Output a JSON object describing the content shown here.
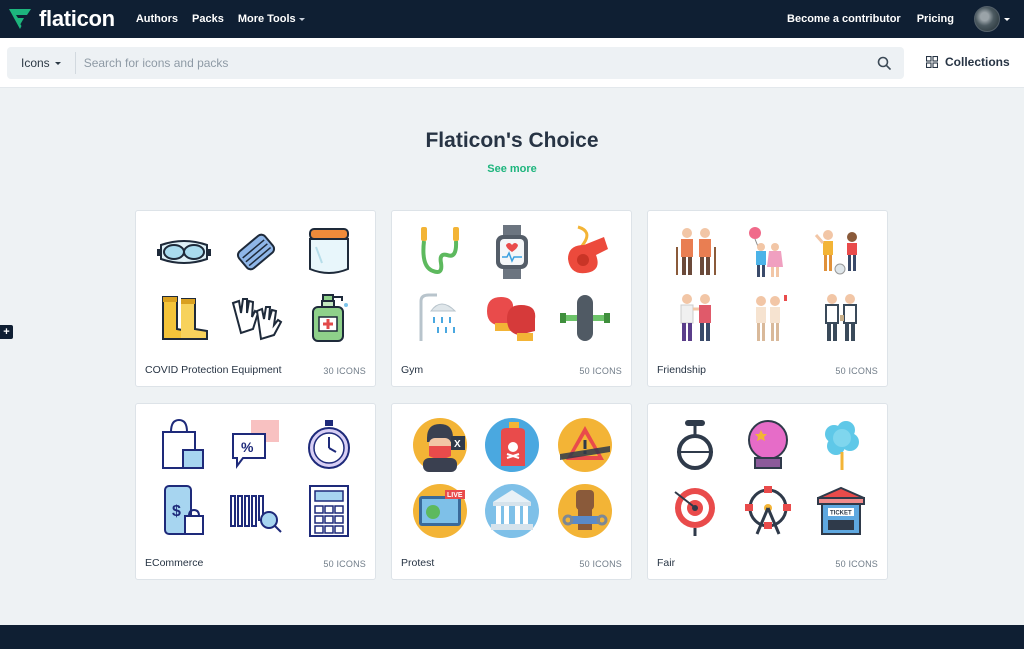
{
  "brand": {
    "name": "flaticon",
    "accent": "#1db57d",
    "nav_bg": "#0f1f33"
  },
  "nav": {
    "links": [
      "Authors",
      "Packs",
      "More Tools"
    ],
    "contributor": "Become a contributor",
    "pricing": "Pricing"
  },
  "search": {
    "type_label": "Icons",
    "placeholder": "Search for icons and packs",
    "collections_label": "Collections"
  },
  "section": {
    "title": "Flaticon's Choice",
    "see_more": "See more"
  },
  "side_tab": "+",
  "packs": [
    {
      "name": "COVID Protection Equipment",
      "count": "30 ICONS",
      "icons": [
        "goggles-icon",
        "face-mask-icon",
        "face-shield-icon",
        "boots-icon",
        "gloves-icon",
        "sanitizer-icon"
      ]
    },
    {
      "name": "Gym",
      "count": "50 ICONS",
      "icons": [
        "jump-rope-icon",
        "smartwatch-icon",
        "whistle-icon",
        "shower-icon",
        "boxing-gloves-icon",
        "expander-icon"
      ]
    },
    {
      "name": "Friendship",
      "count": "50 ICONS",
      "icons": [
        "elderly-couple-icon",
        "balloon-friends-icon",
        "playing-kids-icon",
        "hugging-friends-icon",
        "toast-friends-icon",
        "business-friends-icon"
      ]
    },
    {
      "name": "ECommerce",
      "count": "50 ICONS",
      "icons": [
        "shopping-bag-icon",
        "discount-chat-icon",
        "stopwatch-icon",
        "mobile-payment-icon",
        "barcode-icon",
        "calculator-icon"
      ]
    },
    {
      "name": "Protest",
      "count": "50 ICONS",
      "icons": [
        "protester-icon",
        "spray-can-icon",
        "warning-sign-icon",
        "live-tv-icon",
        "government-building-icon",
        "broken-chain-fist-icon"
      ]
    },
    {
      "name": "Fair",
      "count": "50 ICONS",
      "icons": [
        "unicycle-icon",
        "crystal-ball-icon",
        "cotton-candy-icon",
        "target-icon",
        "ferris-wheel-icon",
        "ticket-booth-icon"
      ]
    }
  ]
}
